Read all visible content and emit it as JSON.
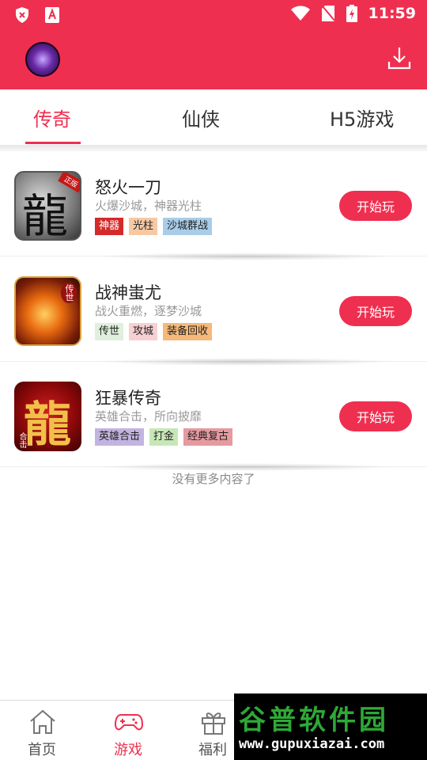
{
  "status_bar": {
    "time": "11:59"
  },
  "colors": {
    "accent": "#ef2f4f"
  },
  "tabs": [
    {
      "label": "传奇",
      "active": true
    },
    {
      "label": "仙侠",
      "active": false
    },
    {
      "label": "H5游戏",
      "active": false
    }
  ],
  "games": [
    {
      "title": "怒火一刀",
      "subtitle": "火爆沙城，神器光柱",
      "play_label": "开始玩",
      "icon_text": "龍",
      "icon_badge": "正版",
      "tags": [
        {
          "label": "神器",
          "color": "#d42a2a",
          "text_color": "#ffffff"
        },
        {
          "label": "光柱",
          "color": "#f7c9a3",
          "text_color": "#222222"
        },
        {
          "label": "沙城群战",
          "color": "#a9cde8",
          "text_color": "#222222"
        }
      ]
    },
    {
      "title": "战神蚩尤",
      "subtitle": "战火重燃，逐梦沙城",
      "play_label": "开始玩",
      "icon_text": "",
      "icon_badge": "传世",
      "tags": [
        {
          "label": "传世",
          "color": "#dff0dc",
          "text_color": "#222222"
        },
        {
          "label": "攻城",
          "color": "#f7d0d2",
          "text_color": "#222222"
        },
        {
          "label": "装备回收",
          "color": "#f6b97a",
          "text_color": "#222222"
        }
      ]
    },
    {
      "title": "狂暴传奇",
      "subtitle": "英雄合击，所向披靡",
      "play_label": "开始玩",
      "icon_text": "龍",
      "icon_badge": "合击",
      "tags": [
        {
          "label": "英雄合击",
          "color": "#c2b4e0",
          "text_color": "#222222"
        },
        {
          "label": "打金",
          "color": "#c8e7b8",
          "text_color": "#222222"
        },
        {
          "label": "经典复古",
          "color": "#e59aa0",
          "text_color": "#222222"
        }
      ]
    }
  ],
  "no_more_text": "没有更多内容了",
  "bottom_nav": [
    {
      "label": "首页",
      "icon": "home-icon",
      "active": false
    },
    {
      "label": "游戏",
      "icon": "gamepad-icon",
      "active": true
    },
    {
      "label": "福利",
      "icon": "gift-icon",
      "active": false
    }
  ],
  "watermark": {
    "title": "谷普软件园",
    "url": "www.gupuxiazai.com"
  }
}
